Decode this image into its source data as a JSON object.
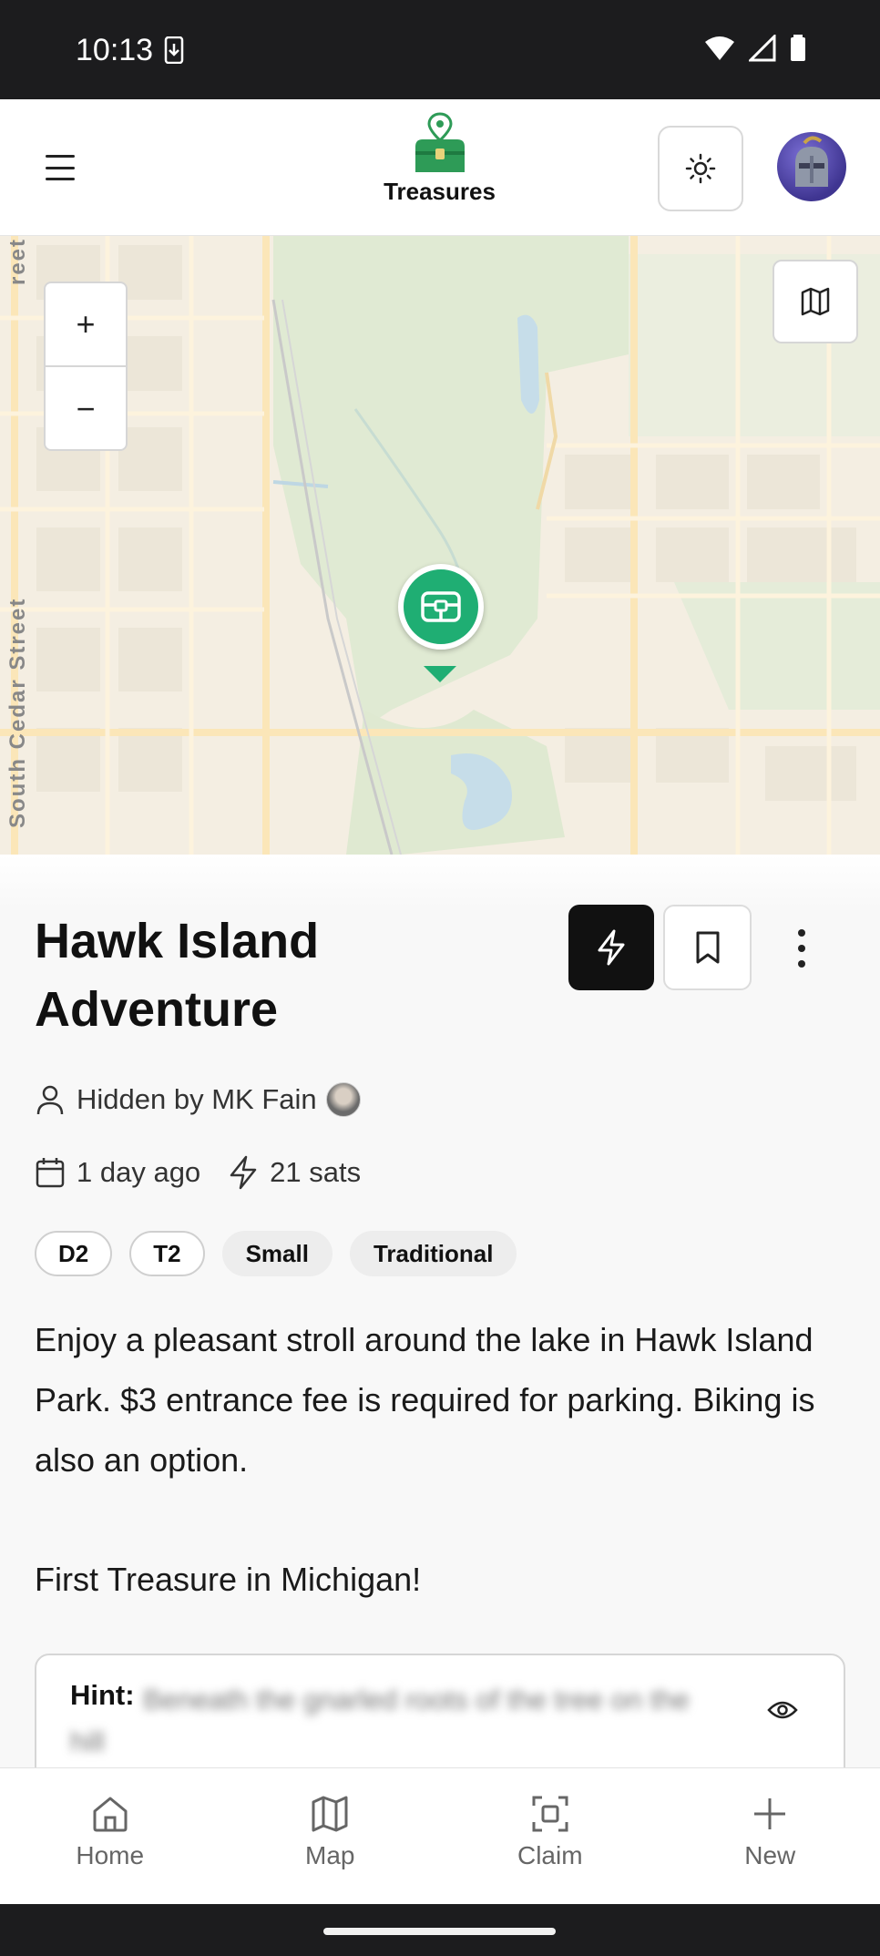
{
  "status_bar": {
    "time": "10:13"
  },
  "header": {
    "title": "Treasures"
  },
  "map": {
    "street_main": "South Cedar Street",
    "street_top": "reet",
    "zoom_in": "+",
    "zoom_out": "−"
  },
  "treasure": {
    "title": "Hawk Island Adventure",
    "hidden_by": "Hidden by MK Fain",
    "age": "1 day ago",
    "sats": "21 sats",
    "tags": [
      "D2",
      "T2",
      "Small",
      "Traditional"
    ],
    "description": "Enjoy a pleasant stroll around the lake in Hawk Island Park. $3 entrance fee is required for parking. Biking is also an option.",
    "description_2": "First Treasure in Michigan!",
    "hint_label": "Hint:",
    "hint_text": "Beneath the gnarled roots of the tree on the hill"
  },
  "bottom_nav": [
    {
      "label": "Home",
      "icon": "home-icon"
    },
    {
      "label": "Map",
      "icon": "map-icon"
    },
    {
      "label": "Claim",
      "icon": "scan-icon"
    },
    {
      "label": "New",
      "icon": "plus-icon"
    }
  ],
  "colors": {
    "accent": "#1fae73",
    "dark": "#111111",
    "map_bg": "#f5efe3",
    "park": "#dfead3"
  }
}
